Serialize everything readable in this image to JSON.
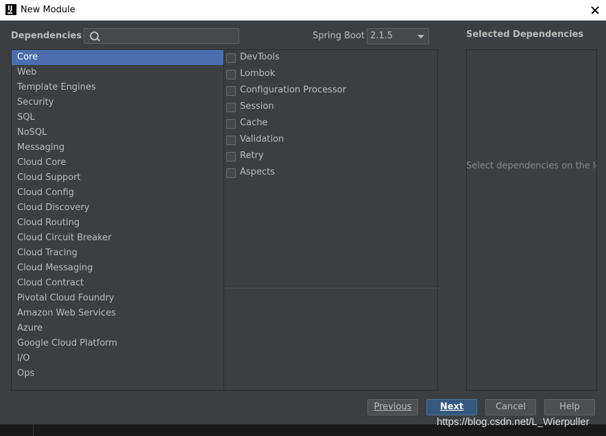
{
  "window": {
    "title": "New Module"
  },
  "header": {
    "dependencies_label": "Dependencies",
    "search_value": "",
    "spring_boot_label": "Spring Boot",
    "spring_boot_version": "2.1.5",
    "selected_label": "Selected Dependencies"
  },
  "categories": [
    "Core",
    "Web",
    "Template Engines",
    "Security",
    "SQL",
    "NoSQL",
    "Messaging",
    "Cloud Core",
    "Cloud Support",
    "Cloud Config",
    "Cloud Discovery",
    "Cloud Routing",
    "Cloud Circuit Breaker",
    "Cloud Tracing",
    "Cloud Messaging",
    "Cloud Contract",
    "Pivotal Cloud Foundry",
    "Amazon Web Services",
    "Azure",
    "Google Cloud Platform",
    "I/O",
    "Ops"
  ],
  "selected_category": "Core",
  "options": [
    "DevTools",
    "Lombok",
    "Configuration Processor",
    "Session",
    "Cache",
    "Validation",
    "Retry",
    "Aspects"
  ],
  "selected_panel": {
    "empty_text": "Select dependencies on the left"
  },
  "buttons": {
    "previous": "Previous",
    "next": "Next",
    "cancel": "Cancel",
    "help": "Help"
  },
  "watermark": "https://blog.csdn.net/L_Wierpuller",
  "colors": {
    "selection": "#4b6eaf",
    "dialog_bg": "#3c3f41",
    "primary_button": "#365880"
  }
}
